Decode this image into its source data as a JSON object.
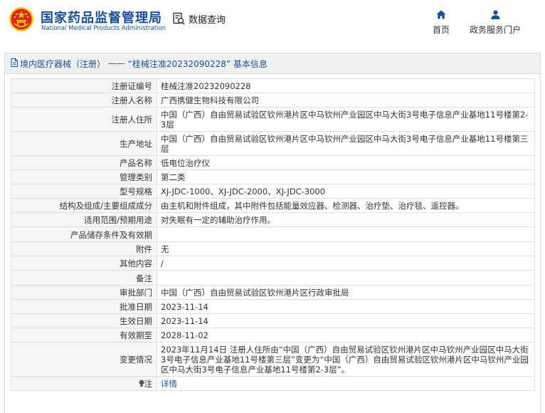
{
  "header": {
    "org_name_cn": "国家药品监督管理局",
    "org_name_en": "National Medical Products Administration",
    "data_query_label": "数据查询",
    "nav": {
      "home_label": "首页",
      "portal_label": "政务服务门户"
    }
  },
  "panel": {
    "category": "境内医疗器械（注册）",
    "separator": "——",
    "reg_no_quoted": "“桂械注准20232090228”",
    "suffix": "基本信息"
  },
  "rows": [
    {
      "label": "注册证编号",
      "value": "桂械注准20232090228"
    },
    {
      "label": "注册人名称",
      "value": "广西携健生物科技有限公司"
    },
    {
      "label": "注册人住所",
      "value": "中国（广西）自由贸易试验区钦州港片区中马钦州产业园区中马大街3号电子信息产业基地11号楼第2-3层"
    },
    {
      "label": "生产地址",
      "value": "中国（广西）自由贸易试验区钦州港片区中马钦州产业园区中马大街3号电子信息产业基地11号楼第三层"
    },
    {
      "label": "产品名称",
      "value": "低电位治疗仪"
    },
    {
      "label": "管理类别",
      "value": "第二类"
    },
    {
      "label": "型号规格",
      "value": "XJ-JDC-1000、XJ-JDC-2000、XJ-JDC-3000"
    },
    {
      "label": "结构及组成/主要组成成分",
      "value": "由主机和附件组成，其中附件包括能量效应器、检测器、治疗垫、治疗毯、遥控器。"
    },
    {
      "label": "适用范围/预期用途",
      "value": "对失眠有一定的辅助治疗作用。"
    },
    {
      "label": "产品储存条件及有效期",
      "value": ""
    },
    {
      "label": "附件",
      "value": "无"
    },
    {
      "label": "其他内容",
      "value": "/"
    },
    {
      "label": "备注",
      "value": ""
    },
    {
      "label": "审批部门",
      "value": "中国（广西）自由贸易试验区钦州港片区行政审批局"
    },
    {
      "label": "批准日期",
      "value": "2023-11-14"
    },
    {
      "label": "生效日期",
      "value": "2023-11-14"
    },
    {
      "label": "有效期至",
      "value": "2028-11-02"
    },
    {
      "label": "变更情况",
      "value": "2023年11月14日 注册人住所由“中国（广西）自由贸易试验区钦州港片区中马钦州产业园区中马大街3号电子信息产业基地11号楼第三层”变更为“中国（广西）自由贸易试验区钦州港片区中马钦州产业园区中马大街3号电子信息产业基地11号楼第2-3层”。"
    }
  ],
  "note_row": {
    "label": "注",
    "link": "详情"
  },
  "colors": {
    "brand_blue": "#1b4f93",
    "emblem_red": "#d7261d",
    "emblem_gold": "#f3c221"
  },
  "icons": [
    "national-emblem-icon",
    "data-query-icon",
    "home-icon",
    "user-icon",
    "document-icon",
    "bulb-icon"
  ]
}
